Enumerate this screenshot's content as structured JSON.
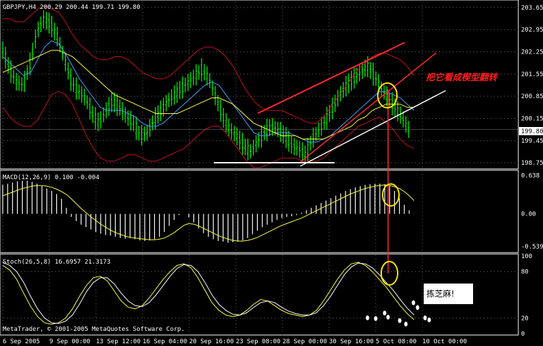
{
  "chart_data": [
    {
      "type": "line",
      "pane": "main",
      "title": "GBPJPY,H4  200.29 200.44 199.71 199.80",
      "y_ticks": [
        "203.65",
        "202.95",
        "202.25",
        "201.55",
        "200.85",
        "200.15",
        "199.45",
        "198.75"
      ],
      "ylim": [
        198.6,
        203.8
      ],
      "current_price": "199.80",
      "annotation": "把它看成楔型翻转",
      "series": [
        {
          "values": [
            202.3,
            201.7,
            201.3,
            201.2,
            201.9,
            202.9,
            203.3,
            203.1,
            202.7,
            202.0,
            201.3,
            201.0,
            200.8,
            200.3,
            200.0,
            200.4,
            200.7,
            200.5,
            200.2,
            200.0,
            199.6,
            199.7,
            200.1,
            200.4,
            200.7,
            200.9,
            201.1,
            201.3,
            201.5,
            201.7,
            201.4,
            200.8,
            200.2,
            199.8,
            199.6,
            199.3,
            199.1,
            199.4,
            199.7,
            199.9,
            199.8,
            199.6,
            199.3,
            199.2,
            199.0,
            199.5,
            199.8,
            200.1,
            200.5,
            200.9,
            201.2,
            201.4,
            201.6,
            201.8,
            201.5,
            201.1,
            200.8,
            200.5,
            200.2,
            199.8
          ]
        },
        {
          "values": [
            202.1,
            201.9,
            201.7,
            201.5,
            201.6,
            202.0,
            202.4,
            202.6,
            202.5,
            202.2,
            201.8,
            201.4,
            201.1,
            200.8,
            200.5,
            200.4,
            200.4,
            200.4,
            200.3,
            200.2,
            200.0,
            199.9,
            199.9,
            200.0,
            200.2,
            200.4,
            200.6,
            200.8,
            201.0,
            201.2,
            201.3,
            201.2,
            200.9,
            200.6,
            200.3,
            200.0,
            199.7,
            199.6,
            199.6,
            199.7,
            199.7,
            199.7,
            199.6,
            199.5,
            199.4,
            199.4,
            199.5,
            199.6,
            199.8,
            200.0,
            200.2,
            200.4,
            200.6,
            200.8,
            201.0,
            201.0,
            200.9,
            200.8,
            200.6,
            200.4
          ]
        },
        {
          "values": [
            201.6,
            201.7,
            201.8,
            201.9,
            202.0,
            202.1,
            202.2,
            202.3,
            202.3,
            202.2,
            202.1,
            201.9,
            201.7,
            201.5,
            201.3,
            201.1,
            200.9,
            200.8,
            200.7,
            200.6,
            200.5,
            200.4,
            200.3,
            200.3,
            200.3,
            200.3,
            200.4,
            200.5,
            200.6,
            200.7,
            200.8,
            200.8,
            200.7,
            200.6,
            200.4,
            200.2,
            200.0,
            199.9,
            199.8,
            199.7,
            199.6,
            199.6,
            199.6,
            199.5,
            199.5,
            199.5,
            199.5,
            199.6,
            199.7,
            199.8,
            199.9,
            200.1,
            200.2,
            200.4,
            200.5,
            200.6,
            200.6,
            200.6,
            200.5,
            200.5
          ]
        },
        {
          "values": [
            203.3,
            203.3,
            203.2,
            203.2,
            203.4,
            203.6,
            203.7,
            203.6,
            203.5,
            203.2,
            202.8,
            202.5,
            202.3,
            202.1,
            202.0,
            202.0,
            202.1,
            202.1,
            202.0,
            201.8,
            201.6,
            201.5,
            201.4,
            201.4,
            201.5,
            201.7,
            201.9,
            202.1,
            202.3,
            202.4,
            202.4,
            202.3,
            202.1,
            201.8,
            201.4,
            201.0,
            200.7,
            200.5,
            200.4,
            200.4,
            200.4,
            200.3,
            200.2,
            200.1,
            200.0,
            200.0,
            200.2,
            200.5,
            200.8,
            201.1,
            201.4,
            201.7,
            201.9,
            202.1,
            202.2,
            202.2,
            202.1,
            202.0,
            201.8,
            201.5
          ]
        },
        {
          "values": [
            200.5,
            200.2,
            200.0,
            199.9,
            199.9,
            200.1,
            200.5,
            200.9,
            201.0,
            200.9,
            200.6,
            200.1,
            199.6,
            199.2,
            198.9,
            198.8,
            198.8,
            198.9,
            199.0,
            199.0,
            198.9,
            198.8,
            198.8,
            198.9,
            199.0,
            199.1,
            199.2,
            199.4,
            199.6,
            199.8,
            199.9,
            199.9,
            199.7,
            199.4,
            199.1,
            198.8,
            198.6,
            198.6,
            198.7,
            198.8,
            198.9,
            198.9,
            198.9,
            198.8,
            198.8,
            198.8,
            198.9,
            199.1,
            199.3,
            199.5,
            199.7,
            199.9,
            200.0,
            200.1,
            200.2,
            200.0,
            199.8,
            199.5,
            199.3,
            199.2
          ]
        }
      ]
    },
    {
      "type": "bar",
      "pane": "macd",
      "title": "MACD(12,26,9) 0.100 -0.004",
      "y_ticks": [
        "0.638",
        "0.00",
        "-0.539"
      ],
      "ylim": [
        -0.62,
        0.7
      ],
      "values": [
        0.48,
        0.5,
        0.52,
        0.54,
        0.55,
        0.55,
        0.53,
        0.5,
        0.46,
        0.42,
        0.38,
        0.33,
        0.25,
        0.1,
        -0.05,
        -0.12,
        -0.18,
        -0.22,
        -0.26,
        -0.3,
        -0.33,
        -0.35,
        -0.36,
        -0.38,
        -0.4,
        -0.41,
        -0.4,
        -0.42,
        -0.44,
        -0.45,
        -0.44,
        -0.42,
        -0.38,
        -0.3,
        -0.2,
        -0.1,
        -0.02,
        0.0,
        -0.06,
        -0.14,
        -0.24,
        -0.32,
        -0.38,
        -0.42,
        -0.45,
        -0.46,
        -0.48,
        -0.47,
        -0.46,
        -0.44,
        -0.4,
        -0.34,
        -0.28,
        -0.22,
        -0.18,
        -0.14,
        -0.1,
        -0.07,
        -0.05,
        -0.04,
        -0.02,
        0.02,
        0.06,
        0.1,
        0.14,
        0.18,
        0.22,
        0.26,
        0.3,
        0.34,
        0.38,
        0.41,
        0.44,
        0.46,
        0.48,
        0.49,
        0.5,
        0.5,
        0.49,
        0.46,
        0.38,
        0.26,
        0.15,
        0.06,
        -0.004
      ],
      "signal": [
        0.3,
        0.33,
        0.36,
        0.39,
        0.42,
        0.44,
        0.46,
        0.47,
        0.47,
        0.46,
        0.44,
        0.41,
        0.37,
        0.32,
        0.25,
        0.17,
        0.09,
        0.02,
        -0.05,
        -0.11,
        -0.17,
        -0.22,
        -0.27,
        -0.31,
        -0.34,
        -0.37,
        -0.39,
        -0.4,
        -0.41,
        -0.42,
        -0.43,
        -0.43,
        -0.42,
        -0.4,
        -0.36,
        -0.31,
        -0.25,
        -0.19,
        -0.16,
        -0.17,
        -0.2,
        -0.24,
        -0.28,
        -0.32,
        -0.36,
        -0.39,
        -0.42,
        -0.44,
        -0.45,
        -0.45,
        -0.44,
        -0.42,
        -0.39,
        -0.35,
        -0.31,
        -0.27,
        -0.23,
        -0.19,
        -0.16,
        -0.13,
        -0.1,
        -0.07,
        -0.03,
        0.01,
        0.05,
        0.09,
        0.13,
        0.17,
        0.21,
        0.25,
        0.29,
        0.33,
        0.36,
        0.39,
        0.42,
        0.44,
        0.46,
        0.47,
        0.48,
        0.47,
        0.45,
        0.42,
        0.37,
        0.3,
        0.22
      ]
    },
    {
      "type": "line",
      "pane": "stoch",
      "title": "Stoch(26,5,8) 16.6957 21.3173",
      "y_ticks": [
        "100",
        "80",
        "20",
        "0"
      ],
      "ylim": [
        0,
        100
      ],
      "annotation": "拣芝麻!",
      "series": [
        {
          "values": [
            88,
            82,
            70,
            52,
            35,
            22,
            14,
            12,
            14,
            20,
            32,
            48,
            62,
            72,
            74,
            68,
            55,
            42,
            34,
            32,
            36,
            46,
            58,
            70,
            80,
            88,
            90,
            85,
            72,
            56,
            40,
            30,
            24,
            22,
            24,
            30,
            38,
            44,
            42,
            36,
            30,
            26,
            24,
            22,
            24,
            30,
            42,
            56,
            70,
            82,
            90,
            92,
            88,
            80,
            70,
            60,
            48,
            36,
            26,
            18
          ]
        },
        {
          "values": [
            92,
            88,
            80,
            66,
            48,
            32,
            20,
            14,
            13,
            16,
            24,
            38,
            54,
            66,
            72,
            72,
            64,
            52,
            42,
            36,
            35,
            40,
            50,
            62,
            74,
            84,
            89,
            88,
            80,
            66,
            50,
            38,
            30,
            25,
            24,
            27,
            34,
            40,
            42,
            40,
            34,
            29,
            26,
            24,
            24,
            27,
            36,
            48,
            62,
            76,
            86,
            91,
            90,
            85,
            76,
            66,
            56,
            44,
            33,
            24
          ]
        }
      ]
    }
  ],
  "x_labels": [
    "6 Sep 2005",
    "9 Sep 00:00",
    "13 Sep 12:00",
    "16 Sep 04:00",
    "20 Sep 16:00",
    "23 Sep 08:00",
    "28 Sep 00:00",
    "30 Sep 16:00",
    "5 Oct 08:00",
    "10 Oct 00:00"
  ],
  "footer": "MetaTrader, © 2001-2005 MetaQuotes Software Corp."
}
